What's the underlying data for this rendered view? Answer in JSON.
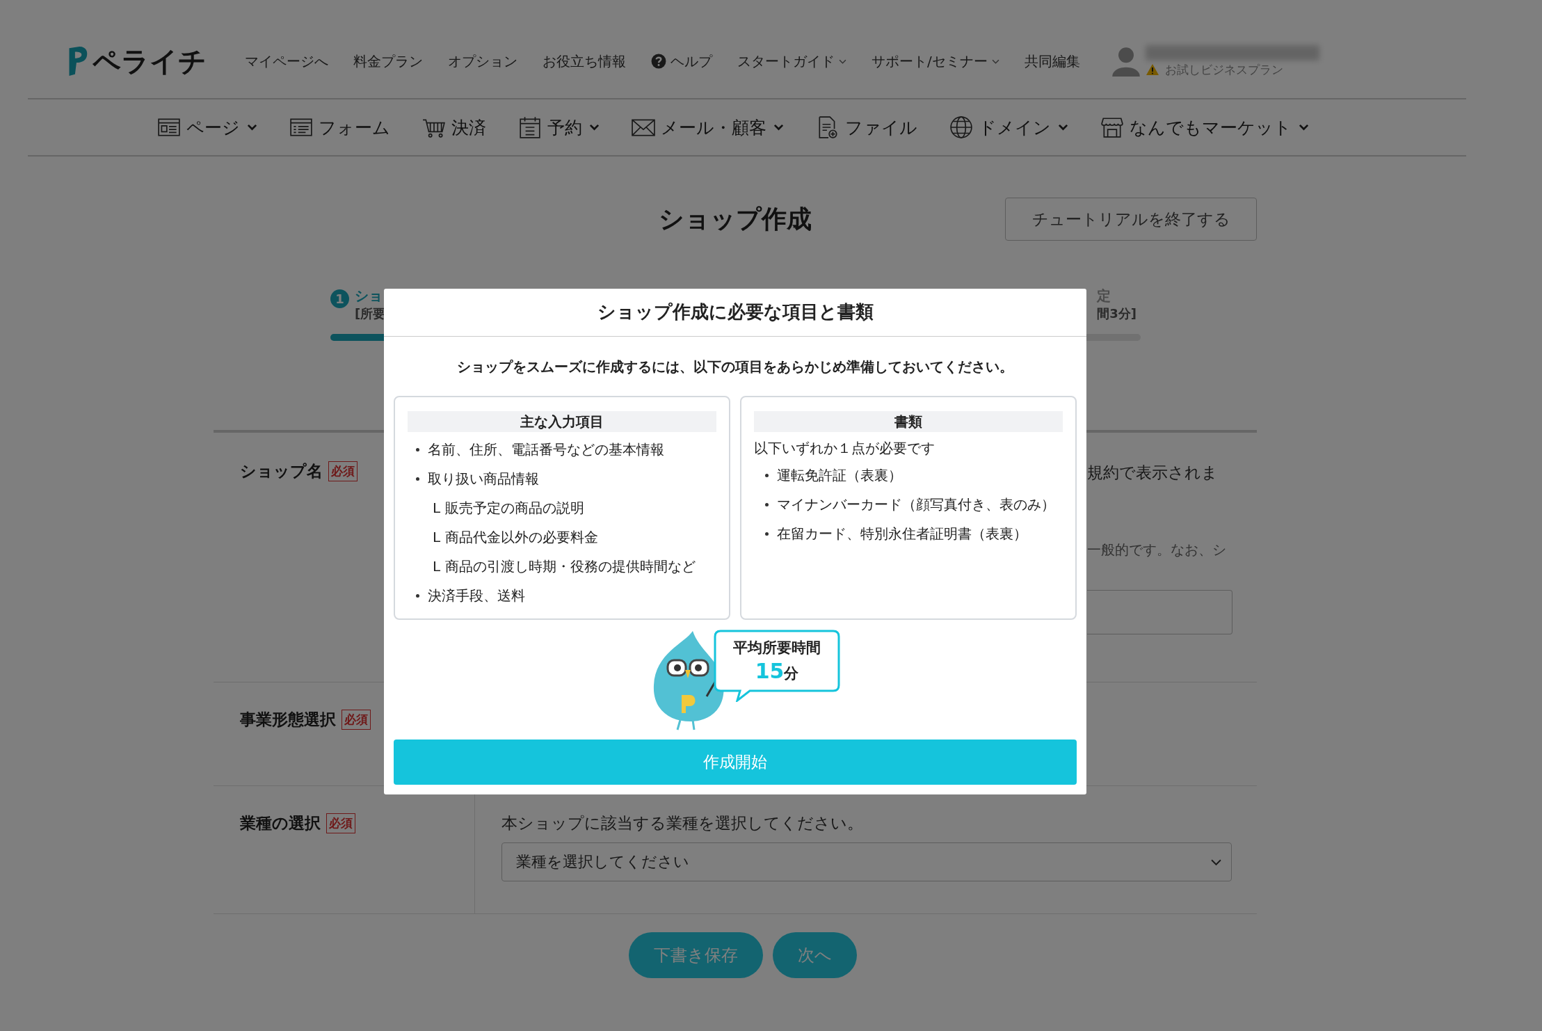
{
  "header": {
    "logo": "ペライチ",
    "nav": [
      {
        "label": "マイページへ",
        "kind": "link",
        "has_menu": false
      },
      {
        "label": "料金プラン",
        "kind": "link",
        "has_menu": false
      },
      {
        "label": "オプション",
        "kind": "link",
        "has_menu": false
      },
      {
        "label": "お役立ち情報",
        "kind": "link",
        "has_menu": false
      },
      {
        "label": "ヘルプ",
        "kind": "help",
        "has_menu": false
      },
      {
        "label": "スタートガイド",
        "kind": "link",
        "has_menu": true
      },
      {
        "label": "サポート/セミナー",
        "kind": "link",
        "has_menu": true
      },
      {
        "label": "共同編集",
        "kind": "link",
        "has_menu": false
      }
    ],
    "account": {
      "plan": "お試しビジネスプラン",
      "warning": true
    }
  },
  "main_nav": [
    {
      "label": "ページ",
      "kind": "page",
      "has_menu": true
    },
    {
      "label": "フォーム",
      "kind": "form",
      "has_menu": false
    },
    {
      "label": "決済",
      "kind": "cart",
      "has_menu": false
    },
    {
      "label": "予約",
      "kind": "calendar",
      "has_menu": true
    },
    {
      "label": "メール・顧客",
      "kind": "mail",
      "has_menu": true
    },
    {
      "label": "ファイル",
      "kind": "file",
      "has_menu": false
    },
    {
      "label": "ドメイン",
      "kind": "globe",
      "has_menu": true
    },
    {
      "label": "なんでもマーケット",
      "kind": "store",
      "has_menu": true
    }
  ],
  "page_title": "ショップ作成",
  "tutorial_button": "チュートリアルを終了する",
  "stepper": {
    "first_step": {
      "number": "1",
      "title": "ショ",
      "note": "[所要",
      "selected": true
    },
    "last_step": {
      "title": "定",
      "note": "間3分]",
      "selected": false
    },
    "level": 0.2
  },
  "form": {
    "rows": [
      {
        "label": "ショップ名",
        "required_badge": "必須",
        "texts": [
          "規約で表示されま",
          "一般的です。なお、シ"
        ],
        "has_input": true
      },
      {
        "label": "事業形態選択",
        "required_badge": "必須"
      },
      {
        "label": "業種の選択",
        "required_badge": "必須",
        "instruction": "本ショップに該当する業種を選択してください。",
        "select_placeholder": "業種を選択してください"
      }
    ]
  },
  "actions": [
    {
      "label": "下書き保存"
    },
    {
      "label": "次へ"
    }
  ],
  "modal": {
    "title": "ショップ作成に必要な項目と書類",
    "intro": "ショップをスムーズに作成するには、以下の項目をあらかじめ準備しておいてください。",
    "cards": [
      {
        "heading": "主な入力項目",
        "items": [
          {
            "text": "名前、住所、電話番号などの基本情報",
            "kind": "bullet"
          },
          {
            "text": "取り扱い商品情報",
            "kind": "bullet"
          },
          {
            "text": "L 販売予定の商品の説明",
            "kind": "sub"
          },
          {
            "text": "L 商品代金以外の必要料金",
            "kind": "sub"
          },
          {
            "text": "L 商品の引渡し時期・役務の提供時間など",
            "kind": "sub"
          },
          {
            "text": "決済手段、送料",
            "kind": "bullet"
          }
        ]
      },
      {
        "heading": "書類",
        "lead": "以下いずれか１点が必要です",
        "items": [
          {
            "text": "運転免許証（表裏）",
            "kind": "bullet"
          },
          {
            "text": "マイナンバーカード（顔写真付き、表のみ）",
            "kind": "bullet"
          },
          {
            "text": "在留カード、特別永住者証明書（表裏）",
            "kind": "bullet"
          }
        ]
      }
    ],
    "bubble": {
      "label": "平均所要時間",
      "value": "15",
      "unit": "分"
    },
    "button": "作成開始"
  }
}
